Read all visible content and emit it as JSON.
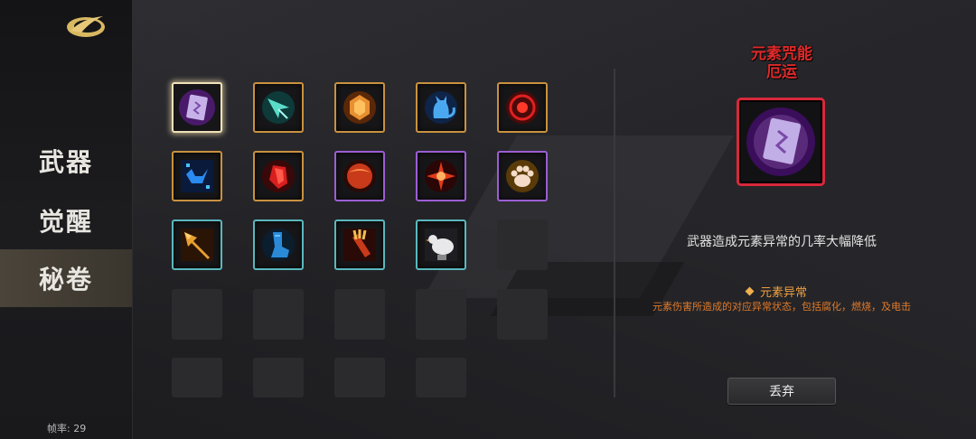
{
  "sidebar": {
    "items": [
      {
        "label": "武器",
        "active": false
      },
      {
        "label": "觉醒",
        "active": false
      },
      {
        "label": "秘卷",
        "active": true
      }
    ],
    "fps": "帧率: 29"
  },
  "grid": {
    "slots": [
      {
        "name": "purple-card-scroll",
        "frame": "gold",
        "selected": true
      },
      {
        "name": "teal-arrowhead-scroll",
        "frame": "gold"
      },
      {
        "name": "amber-gem-scroll",
        "frame": "gold"
      },
      {
        "name": "blue-cat-scroll",
        "frame": "gold"
      },
      {
        "name": "red-rune-scroll",
        "frame": "gold"
      },
      {
        "name": "blue-crystal-scroll",
        "frame": "gold"
      },
      {
        "name": "red-shard-scroll",
        "frame": "gold"
      },
      {
        "name": "red-orb-scroll",
        "frame": "purple"
      },
      {
        "name": "red-star-scroll",
        "frame": "purple"
      },
      {
        "name": "paw-scroll",
        "frame": "purple"
      },
      {
        "name": "golden-arrow-scroll",
        "frame": "cyan"
      },
      {
        "name": "blue-boot-scroll",
        "frame": "cyan"
      },
      {
        "name": "arrow-quiver-scroll",
        "frame": "cyan"
      },
      {
        "name": "white-chicken-scroll",
        "frame": "cyan"
      }
    ]
  },
  "detail": {
    "title_line1": "元素咒能",
    "title_line2": "厄运",
    "icon": "purple-card-icon",
    "description": "武器造成元素异常的几率大幅降低",
    "keyword": "元素异常",
    "keyword_desc": "元素伤害所造成的对应异常状态，包括腐化，燃烧，及电击",
    "discard_label": "丢弃"
  },
  "colors": {
    "frame_gold": "#c9913f",
    "frame_purple": "#9b5ed4",
    "frame_cyan": "#5ab8be",
    "title_red": "#e02a2a",
    "keyword_orange": "#f0a040"
  }
}
